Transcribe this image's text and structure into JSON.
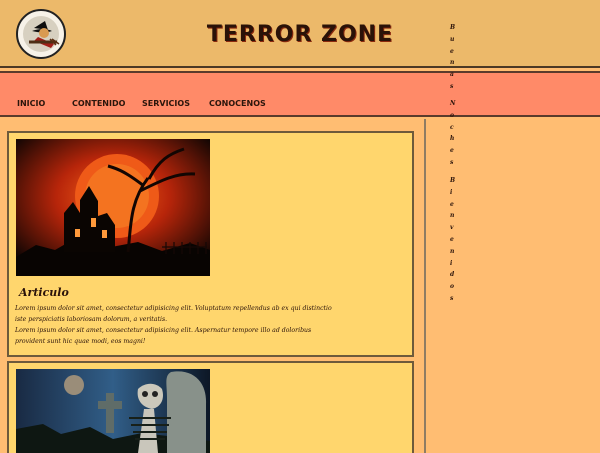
{
  "header": {
    "title": "TERROR ZONE"
  },
  "nav": {
    "items": [
      {
        "label": "INICIO"
      },
      {
        "label": "CONTENIDO"
      },
      {
        "label": "SERVICIOS"
      },
      {
        "label": "CONOCENOS"
      }
    ]
  },
  "articles": [
    {
      "title": "Articulo",
      "lines": [
        "Lorem ipsum dolor sit amet, consectetur adipisicing elit. Voluptatum repellendus ab ex qui distinctio",
        "iste perspiciatis laboriosam dolorum, a veritatis.",
        "Lorem ipsum dolor sit amet, consectetur adipisicing elit. Aspernatur tempore illo ad doloribus",
        "provident sunt hic quae modi, eos magni!"
      ]
    }
  ],
  "aside": {
    "lines": [
      "Buenas",
      "Noches",
      "Bienvenidos"
    ]
  },
  "colors": {
    "header_bg": "#ecb96a",
    "nav_bg": "#ff8a68",
    "page_bg": "#ffbd72",
    "article_bg": "#ffd66d"
  }
}
